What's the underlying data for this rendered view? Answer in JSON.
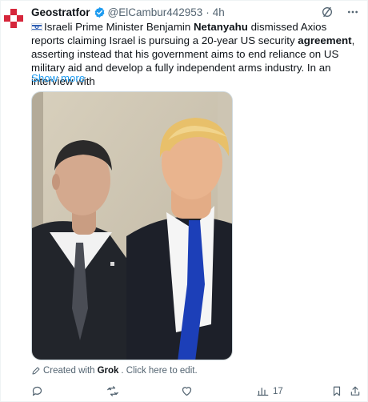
{
  "tweet": {
    "author": {
      "display_name": "Geostratfor",
      "handle": "@ElCambur442953",
      "time": "4h",
      "verified": true,
      "verified_color": "#1d9bf0",
      "avatar_icon": "red-cross-logo",
      "avatar_color": "#e0245e"
    },
    "separator": "·",
    "body": {
      "flag_icon": "israel-flag-icon",
      "part1": "Israeli Prime Minister Benjamin ",
      "bold1": "Netanyahu",
      "part2": " dismissed Axios reports claiming Israel is pursuing a 20-year US security ",
      "bold2": "agreement",
      "part3": ", asserting instead that his government aims to end reliance on US military aid and develop a fully independent arms industry. In an interview with"
    },
    "show_more": "Show more",
    "media": {
      "description_icon": "photo-two-men-suits"
    },
    "credit": {
      "prefix": "Created with",
      "brand": "Grok",
      "suffix": ". Click here to edit."
    },
    "actions": {
      "reply_count": "",
      "repost_count": "",
      "like_count": "",
      "views_count": "17"
    },
    "colors": {
      "link": "#1d9bf0",
      "muted": "#536471",
      "text": "#0f1419"
    }
  }
}
